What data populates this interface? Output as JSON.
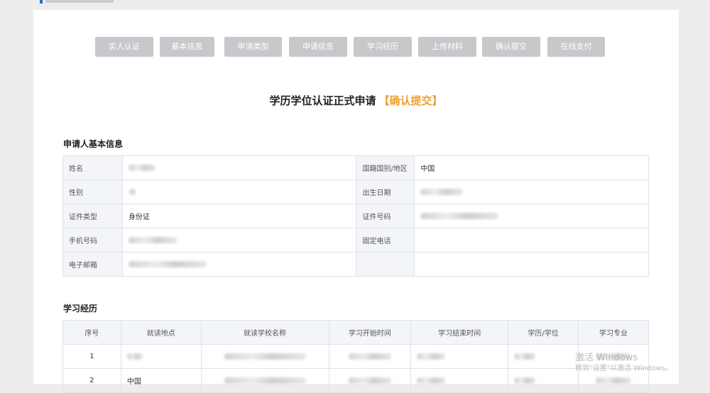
{
  "steps": [
    "实人认证",
    "基本信息",
    "申请类型",
    "申请信息",
    "学习经历",
    "上传材料",
    "确认提交",
    "在线支付"
  ],
  "page_title": "学历学位认证正式申请",
  "page_title_highlight": "【确认提交】",
  "basic_info": {
    "section_title": "申请人基本信息",
    "name_label": "姓名",
    "nationality_label": "国籍国别/地区",
    "nationality_value": "中国",
    "gender_label": "性别",
    "birthdate_label": "出生日期",
    "id_type_label": "证件类型",
    "id_type_value": "身份证",
    "id_number_label": "证件号码",
    "mobile_label": "手机号码",
    "landline_label": "固定电话",
    "email_label": "电子邮箱"
  },
  "study": {
    "section_title": "学习经历",
    "headers": [
      "序号",
      "就读地点",
      "就读学校名称",
      "学习开始时间",
      "学习结束时间",
      "学历/学位",
      "学习专业"
    ],
    "rows": [
      {
        "index": "1",
        "location": ""
      },
      {
        "index": "2",
        "location": "中国"
      }
    ]
  },
  "watermark": {
    "line1": "激活 Windows",
    "line2": "转到\"设置\"以激活 Windows。"
  }
}
